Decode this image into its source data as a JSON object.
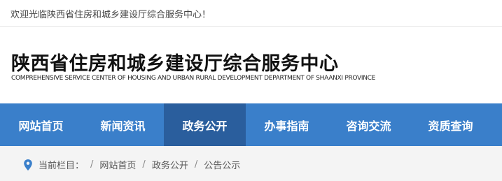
{
  "topbar": {
    "welcome": "欢迎光临陕西省住房和城乡建设厅综合服务中心！"
  },
  "header": {
    "title_cn": "陕西省住房和城乡建设厅综合服务中心",
    "title_en": "COMPREHENSIVE SERVICE CENTER OF HOUSING AND URBAN RURAL DEVELOPMENT DEPARTMENT OF SHAANXI PROVINCE"
  },
  "nav": {
    "items": [
      {
        "label": "网站首页"
      },
      {
        "label": "新闻资讯"
      },
      {
        "label": "政务公开",
        "active": true
      },
      {
        "label": "办事指南"
      },
      {
        "label": "咨询交流"
      },
      {
        "label": "资质查询"
      }
    ]
  },
  "breadcrumb": {
    "icon": "location-pin-icon",
    "label": "当前栏目：",
    "separator": "/",
    "items": [
      "网站首页",
      "政务公开",
      "公告公示"
    ]
  },
  "colors": {
    "nav_bg": "#3a7fca",
    "nav_active_bg": "#2a5e9d",
    "breadcrumb_bg": "#f4f4f4",
    "pin": "#3a7fca"
  }
}
